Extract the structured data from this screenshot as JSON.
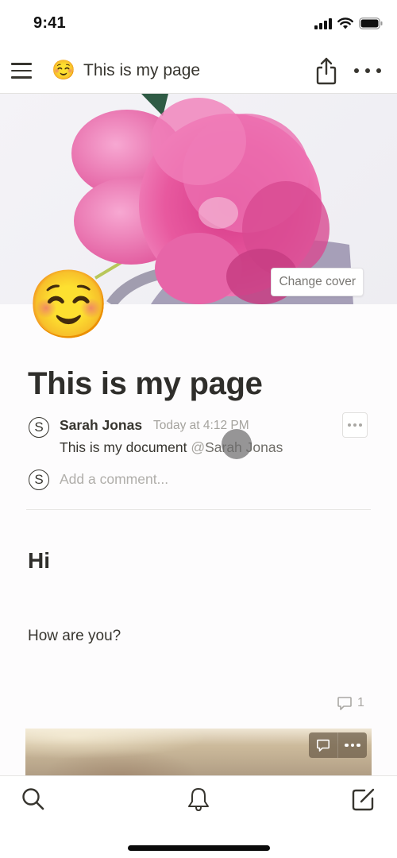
{
  "status_bar": {
    "time": "9:41",
    "icons": [
      "cellular-signal-icon",
      "wifi-icon",
      "battery-icon"
    ]
  },
  "topbar": {
    "menu_icon": "hamburger-menu-icon",
    "page_emoji": "☺️",
    "page_title": "This is my page",
    "share_icon": "share-icon",
    "more_icon": "more-horizontal-icon"
  },
  "cover": {
    "description": "pink peony flower photo",
    "change_cover_label": "Change cover",
    "colors": {
      "petal": "#e6509c",
      "petal_light": "#f08ac0",
      "leaf": "#2f5b45",
      "background": "#f2f1f5"
    }
  },
  "page": {
    "icon_emoji": "☺️",
    "title": "This is my page"
  },
  "comment": {
    "avatar_letter": "S",
    "author": "Sarah Jonas",
    "timestamp": "Today at 4:12 PM",
    "text": "This is my document ",
    "mention_at": "@",
    "mention_name": "Sarah Jonas",
    "more_icon": "more-horizontal-icon"
  },
  "add_comment": {
    "avatar_letter": "S",
    "placeholder": "Add a comment..."
  },
  "blocks": {
    "heading": "Hi",
    "paragraph": "How are you?",
    "comment_count": "1"
  },
  "image_block": {
    "description": "blurred beige photo",
    "comment_icon": "comment-icon",
    "more_icon": "more-horizontal-icon"
  },
  "bottombar": {
    "items": [
      {
        "name": "search",
        "icon": "search-icon"
      },
      {
        "name": "notifications",
        "icon": "bell-icon"
      },
      {
        "name": "new-page",
        "icon": "compose-icon"
      }
    ]
  }
}
